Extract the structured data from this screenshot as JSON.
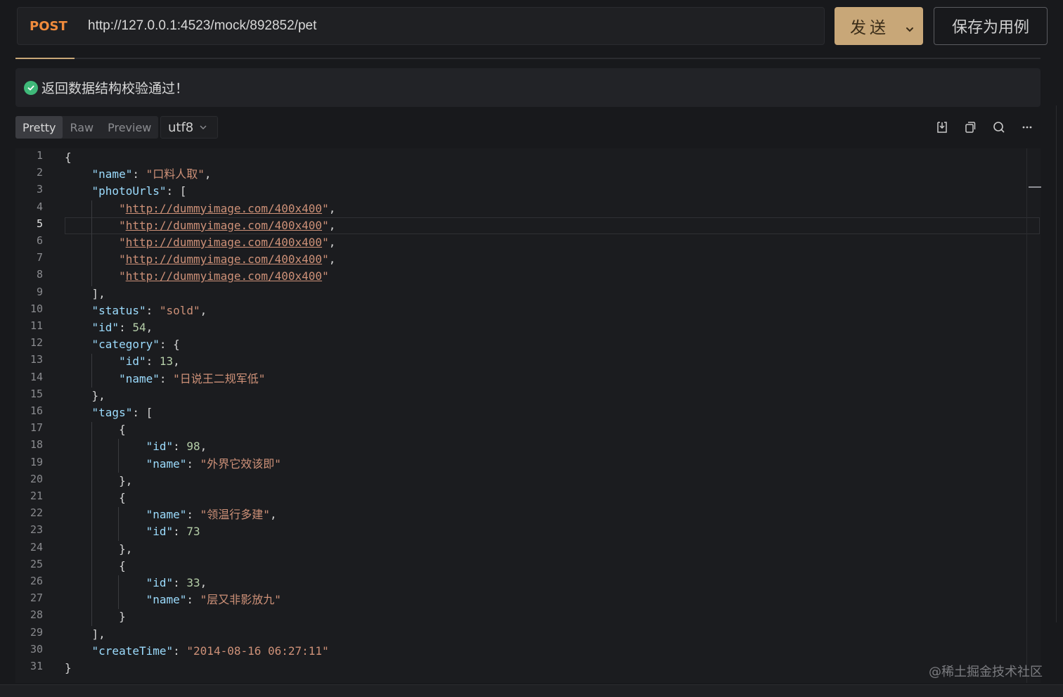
{
  "request": {
    "method": "POST",
    "url": "http://127.0.0.1:4523/mock/892852/pet"
  },
  "actions": {
    "send_label": "发送",
    "save_label": "保存为用例"
  },
  "validation": {
    "message": "返回数据结构校验通过！",
    "status_color": "#3fb979"
  },
  "view_tabs": [
    {
      "label": "Pretty",
      "active": true
    },
    {
      "label": "Raw",
      "active": false
    },
    {
      "label": "Preview",
      "active": false
    }
  ],
  "encoding": "utf8",
  "toolbar_icons": [
    "download-icon",
    "copy-icon",
    "search-icon",
    "more-icon"
  ],
  "editor": {
    "current_line": 5,
    "lines": [
      "{",
      "    \"name\": \"口料人取\",",
      "    \"photoUrls\": [",
      "        \"http://dummyimage.com/400x400\",",
      "        \"http://dummyimage.com/400x400\",",
      "        \"http://dummyimage.com/400x400\",",
      "        \"http://dummyimage.com/400x400\",",
      "        \"http://dummyimage.com/400x400\"",
      "    ],",
      "    \"status\": \"sold\",",
      "    \"id\": 54,",
      "    \"category\": {",
      "        \"id\": 13,",
      "        \"name\": \"日说王二规军低\"",
      "    },",
      "    \"tags\": [",
      "        {",
      "            \"id\": 98,",
      "            \"name\": \"外界它效该即\"",
      "        },",
      "        {",
      "            \"name\": \"领温行多建\",",
      "            \"id\": 73",
      "        },",
      "        {",
      "            \"id\": 33,",
      "            \"name\": \"层又非影放九\"",
      "        }",
      "    ],",
      "    \"createTime\": \"2014-08-16 06:27:11\"",
      "}"
    ]
  },
  "watermark": "@稀土掘金技术社区",
  "colors": {
    "accent": "#c8a778",
    "method": "#f08b3c",
    "json_key": "#9cdcfe",
    "json_string": "#ce9178",
    "json_number": "#b5cea8"
  }
}
